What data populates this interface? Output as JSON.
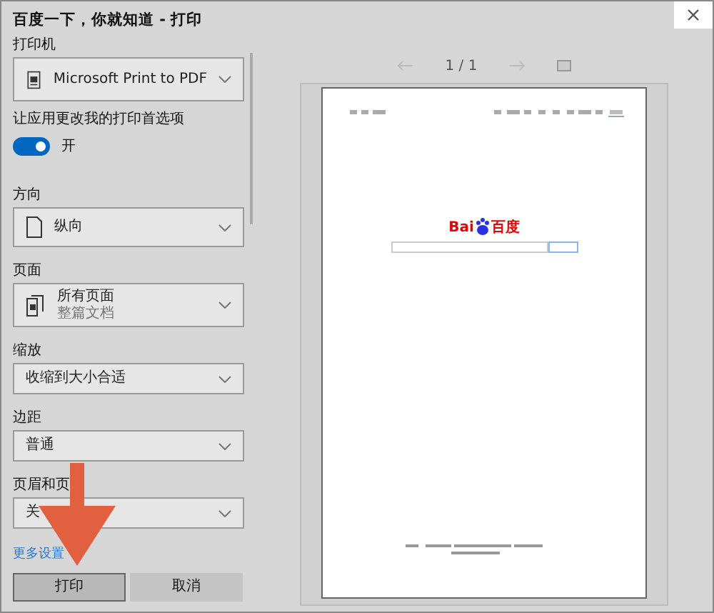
{
  "window": {
    "title": "百度一下，你就知道 - 打印"
  },
  "settings": [
    {
      "label": "打印机",
      "kind": "printer",
      "value": "Microsoft Print to PDF"
    },
    {
      "label": "让应用更改我的打印首选项",
      "kind": "toggle",
      "on": true,
      "value": "开"
    }
  ],
  "layout_settings": [
    {
      "label": "方向",
      "kind": "portrait",
      "value": "纵向"
    },
    {
      "label": "页面",
      "kind": "pages",
      "value": "所有页面",
      "sub": "整篇文档"
    },
    {
      "label": "缩放",
      "kind": "plain",
      "value": "收缩到大小合适"
    },
    {
      "label": "边距",
      "kind": "plain",
      "value": "普通"
    },
    {
      "label": "页眉和页",
      "kind": "plain",
      "value": "关"
    }
  ],
  "more_link": "更多设置",
  "buttons": [
    {
      "label": "打印",
      "primary": true
    },
    {
      "label": "取消",
      "primary": false
    }
  ],
  "preview": {
    "page_indicator": "1 / 1",
    "logo_left": "Bai",
    "logo_right": "百度"
  },
  "annotation": {
    "kind": "down-arrow"
  }
}
